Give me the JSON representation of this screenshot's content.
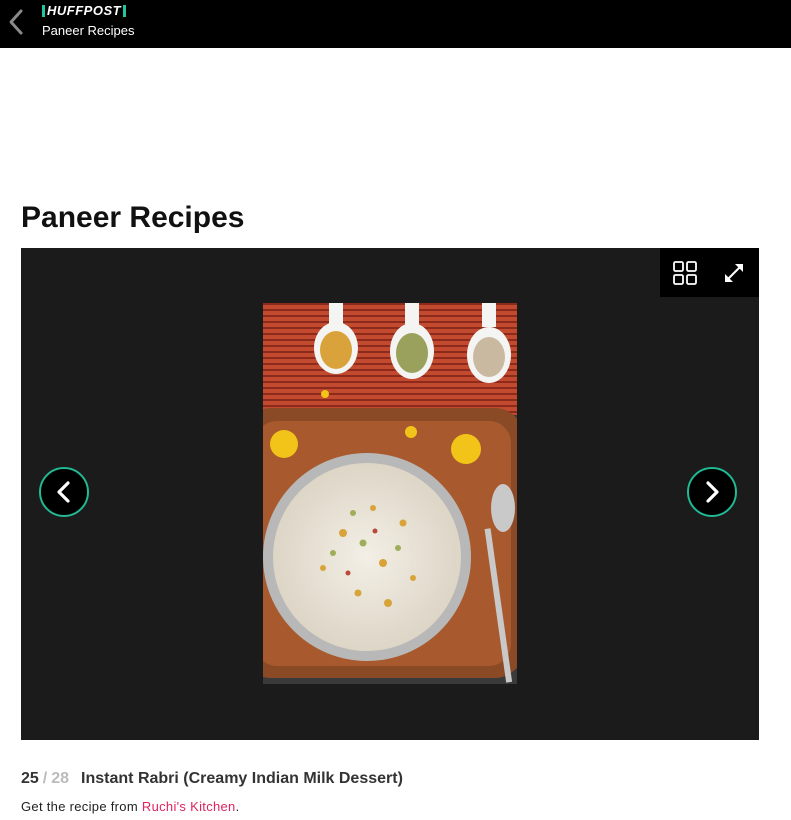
{
  "header": {
    "brand": "HUFFPOST",
    "title": "Paneer Recipes",
    "back_icon": "chevron-left-icon"
  },
  "page": {
    "title": "Paneer Recipes"
  },
  "gallery": {
    "tools": {
      "grid_icon": "grid-view-icon",
      "fullscreen_icon": "fullscreen-expand-icon"
    },
    "nav": {
      "prev_icon": "chevron-left-icon",
      "next_icon": "chevron-right-icon"
    },
    "image": {
      "subject": "photo of rabri in a steel bowl on a wooden tray with spoons of nuts"
    },
    "colors": {
      "accent": "#21b893",
      "background": "#1b1b1b",
      "link": "#e0245e"
    }
  },
  "caption": {
    "current": "25",
    "separator": "/",
    "total": "28",
    "title": "Instant Rabri (Creamy Indian Milk Dessert)",
    "credit_prefix": "Get the recipe from ",
    "credit_link": "Ruchi's Kitchen",
    "credit_suffix": "."
  }
}
